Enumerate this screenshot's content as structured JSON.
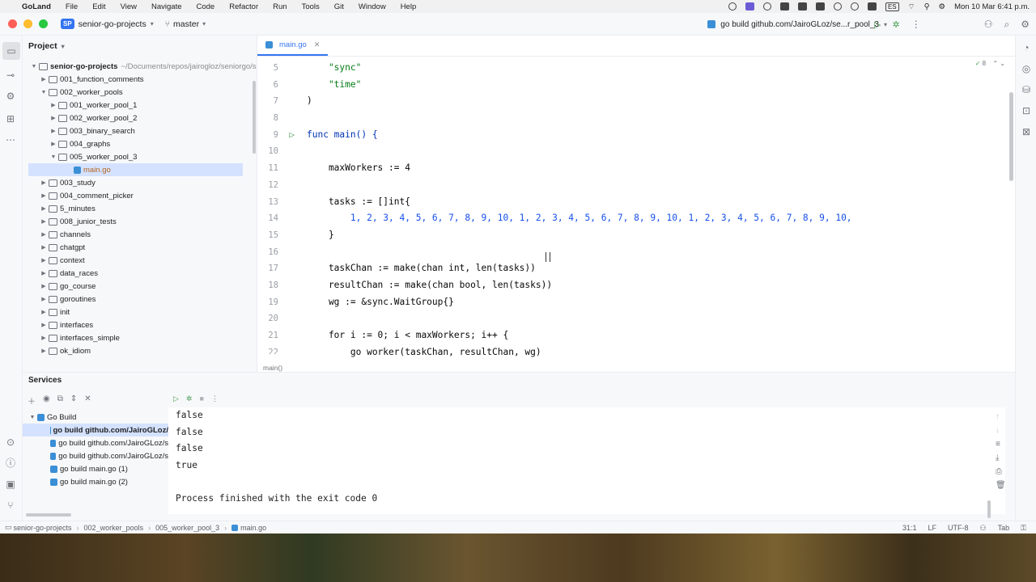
{
  "menubar": {
    "app": "GoLand",
    "items": [
      "File",
      "Edit",
      "View",
      "Navigate",
      "Code",
      "Refactor",
      "Run",
      "Tools",
      "Git",
      "Window",
      "Help"
    ],
    "input_source": "ES",
    "datetime": "Mon 10 Mar 6:41 p.m."
  },
  "titlebar": {
    "project_badge": "SP",
    "project_name": "senior-go-projects",
    "branch": "master",
    "run_config": "go build github.com/JairoGLoz/se...r_pool_3"
  },
  "project_panel": {
    "title": "Project",
    "root": "senior-go-projects",
    "root_path": "~/Documents/repos/jairogloz/seniorgo/s",
    "items": [
      {
        "label": "001_function_comments"
      },
      {
        "label": "002_worker_pools"
      },
      {
        "label": "001_worker_pool_1"
      },
      {
        "label": "002_worker_pool_2"
      },
      {
        "label": "003_binary_search"
      },
      {
        "label": "004_graphs"
      },
      {
        "label": "005_worker_pool_3"
      },
      {
        "label": "main.go"
      },
      {
        "label": "003_study"
      },
      {
        "label": "004_comment_picker"
      },
      {
        "label": "5_minutes"
      },
      {
        "label": "008_junior_tests"
      },
      {
        "label": "channels"
      },
      {
        "label": "chatgpt"
      },
      {
        "label": "context"
      },
      {
        "label": "data_races"
      },
      {
        "label": "go_course"
      },
      {
        "label": "goroutines"
      },
      {
        "label": "init"
      },
      {
        "label": "interfaces"
      },
      {
        "label": "interfaces_simple"
      },
      {
        "label": "ok_idiom"
      }
    ]
  },
  "editor": {
    "tab": "main.go",
    "inspection_count": "8",
    "line_numbers": [
      "5",
      "6",
      "7",
      "8",
      "9",
      "10",
      "11",
      "12",
      "13",
      "14",
      "15",
      "16",
      "17",
      "18",
      "19",
      "20",
      "21",
      "22"
    ],
    "code_lines": [
      "    \"sync\"",
      "    \"time\"",
      ")",
      "",
      "func main() {",
      "",
      "    maxWorkers := 4",
      "",
      "    tasks := []int{",
      "        1, 2, 3, 4, 5, 6, 7, 8, 9, 10, 1, 2, 3, 4, 5, 6, 7, 8, 9, 10, 1, 2, 3, 4, 5, 6, 7, 8, 9, 10,",
      "    }",
      "",
      "    taskChan := make(chan int, len(tasks))",
      "    resultChan := make(chan bool, len(tasks))",
      "    wg := &sync.WaitGroup{}",
      "",
      "    for i := 0; i < maxWorkers; i++ {",
      "        go worker(taskChan, resultChan, wg)"
    ],
    "breadcrumb": "main()"
  },
  "services": {
    "title": "Services",
    "group": "Go Build",
    "items": [
      "go build github.com/JairoGLoz/",
      "go build github.com/JairoGLoz/s",
      "go build github.com/JairoGLoz/s",
      "go build main.go (1)",
      "go build main.go (2)"
    ],
    "output": [
      "false",
      "false",
      "false",
      "true",
      "",
      "Process finished with the exit code 0"
    ]
  },
  "statusbar": {
    "crumbs": [
      "senior-go-projects",
      "002_worker_pools",
      "005_worker_pool_3",
      "main.go"
    ],
    "position": "31:1",
    "line_sep": "LF",
    "encoding": "UTF-8",
    "indent": "Tab"
  }
}
